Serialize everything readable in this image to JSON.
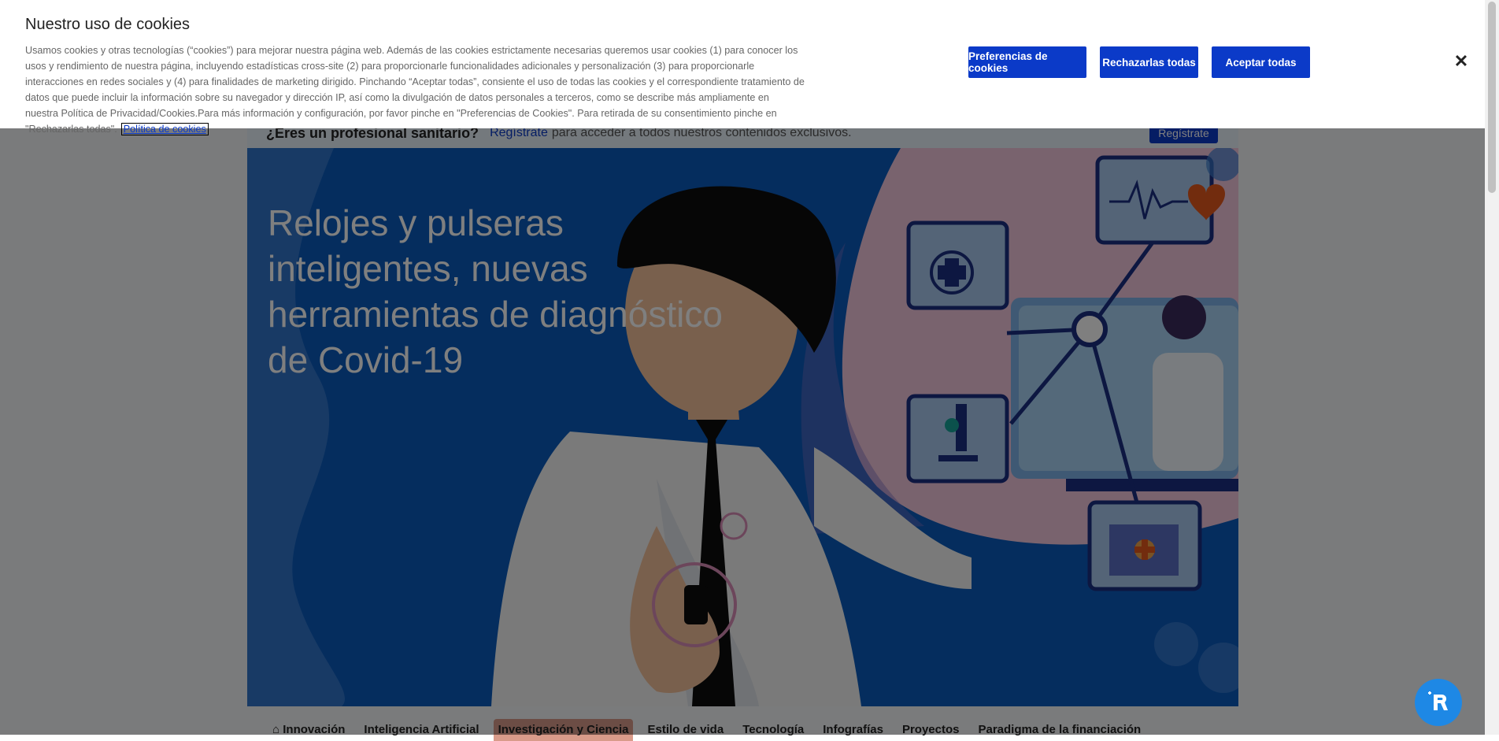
{
  "pro_bar": {
    "question": "¿Eres un profesional sanitario?",
    "link": "Regístrate",
    "rest": "para acceder a todos nuestros contenidos exclusivos.",
    "button": "Regístrate"
  },
  "hero": {
    "title": "Relojes y pulseras inteligentes, nuevas herramientas de diagnóstico de Covid-19"
  },
  "tabs": [
    {
      "label": "Innovación",
      "icon": "home-icon"
    },
    {
      "label": "Inteligencia Artificial"
    },
    {
      "label": "Investigación y Ciencia",
      "active": true
    },
    {
      "label": "Estilo de vida"
    },
    {
      "label": "Tecnología"
    },
    {
      "label": "Infografías"
    },
    {
      "label": "Proyectos"
    },
    {
      "label": "Paradigma de la financiación"
    }
  ],
  "cookie_banner": {
    "title": "Nuestro uso de cookies",
    "text": "Usamos cookies y otras tecnologías (“cookies”) para mejorar nuestra página web. Además de las cookies estrictamente necesarias queremos usar cookies (1) para conocer los usos y rendimiento de nuestra página, incluyendo estadísticas cross-site (2) para proporcionarle funcionalidades adicionales y personalización (3) para proporcionarle interacciones en redes sociales y (4) para finalidades de marketing dirigido. Pinchando “Aceptar todas”, consiente el uso de todas las cookies y el correspondiente tratamiento de datos que puede incluir la información sobre su navegador y dirección IP, así como la divulgación de datos personales a terceros, como se describe más ampliamente en nuestra Política de Privacidad/Cookies.Para más información y configuración, por favor pinche en \"Preferencias de Cookies\". Para retirada de su consentimiento pinche en \"Rechazarlas todas\".",
    "policy_link": "Política de cookies",
    "preferences_button": "Preferencias de cookies",
    "reject_button": "Rechazarlas todas",
    "accept_button": "Aceptar todas",
    "close_icon": "close-icon"
  },
  "colors": {
    "accent": "#0b3ac8",
    "hero_bg": "#0a5bbd",
    "fab": "#1e88e5"
  }
}
